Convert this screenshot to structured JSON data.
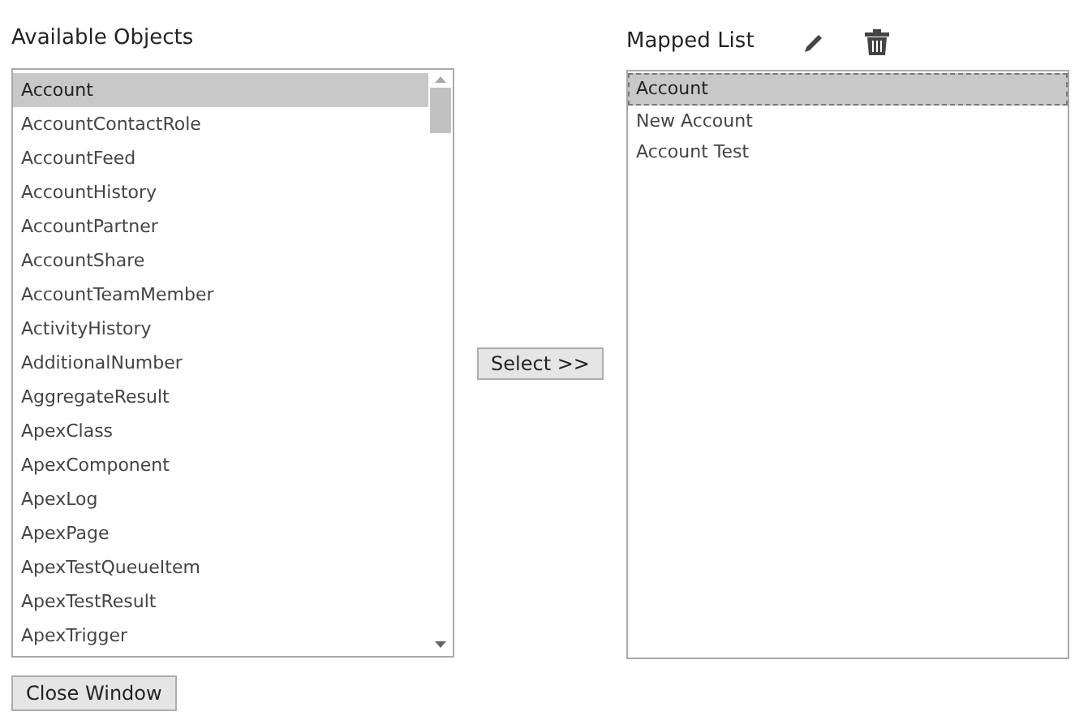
{
  "available": {
    "title": "Available Objects",
    "items": [
      {
        "label": "Account",
        "selected": true
      },
      {
        "label": "AccountContactRole",
        "selected": false
      },
      {
        "label": "AccountFeed",
        "selected": false
      },
      {
        "label": "AccountHistory",
        "selected": false
      },
      {
        "label": "AccountPartner",
        "selected": false
      },
      {
        "label": "AccountShare",
        "selected": false
      },
      {
        "label": "AccountTeamMember",
        "selected": false
      },
      {
        "label": "ActivityHistory",
        "selected": false
      },
      {
        "label": "AdditionalNumber",
        "selected": false
      },
      {
        "label": "AggregateResult",
        "selected": false
      },
      {
        "label": "ApexClass",
        "selected": false
      },
      {
        "label": "ApexComponent",
        "selected": false
      },
      {
        "label": "ApexLog",
        "selected": false
      },
      {
        "label": "ApexPage",
        "selected": false
      },
      {
        "label": "ApexTestQueueItem",
        "selected": false
      },
      {
        "label": "ApexTestResult",
        "selected": false
      },
      {
        "label": "ApexTrigger",
        "selected": false
      }
    ]
  },
  "select_button": "Select >>",
  "mapped": {
    "title": "Mapped List",
    "items": [
      {
        "label": "Account",
        "selected": true
      },
      {
        "label": "New Account",
        "selected": false
      },
      {
        "label": "Account Test",
        "selected": false
      }
    ]
  },
  "close_button": "Close Window"
}
